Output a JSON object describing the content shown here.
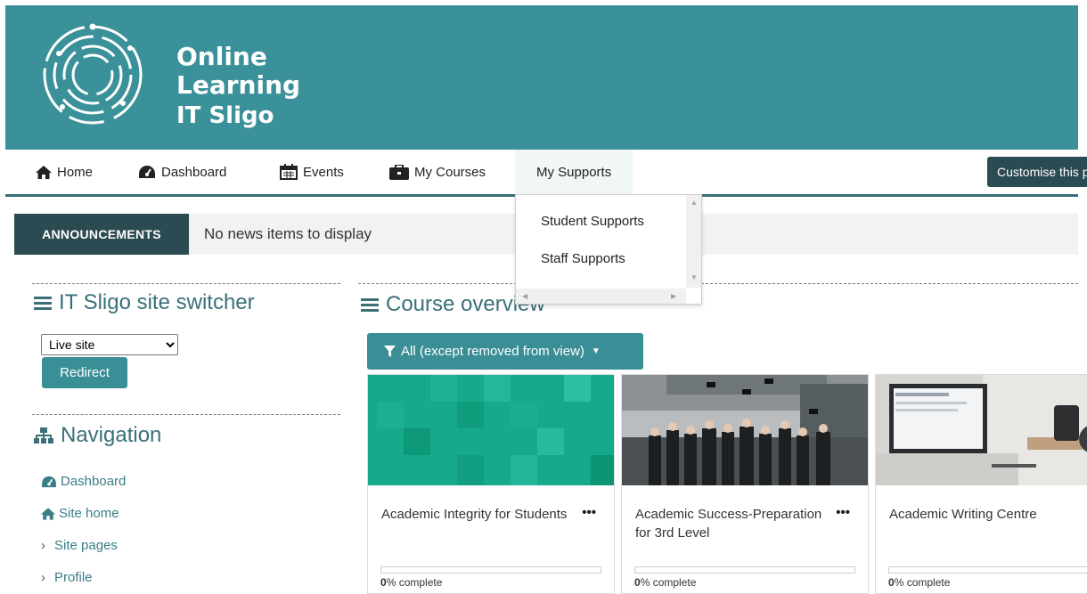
{
  "brand": {
    "line1": "Online",
    "line2": "Learning",
    "line3": "IT Sligo"
  },
  "nav": {
    "home": "Home",
    "dashboard": "Dashboard",
    "events": "Events",
    "my_courses": "My Courses",
    "my_supports": "My Supports",
    "customise": "Customise this page"
  },
  "supports_menu": [
    "Student Supports",
    "Staff Supports"
  ],
  "announcements": {
    "label": "ANNOUNCEMENTS",
    "text": "No news items to display"
  },
  "site_switcher": {
    "title": "IT Sligo site switcher",
    "selected": "Live site",
    "button": "Redirect"
  },
  "navigation": {
    "title": "Navigation",
    "items": [
      "Dashboard",
      "Site home",
      "Site pages",
      "Profile"
    ]
  },
  "course_overview": {
    "title": "Course overview",
    "filter": "All (except removed from view)",
    "courses": [
      {
        "title": "Academic Integrity for Students",
        "progress": 0,
        "progress_label": "0",
        "complete_suffix": "% complete"
      },
      {
        "title": "Academic Success-Preparation for 3rd Level",
        "progress": 0,
        "progress_label": "0",
        "complete_suffix": "% complete"
      },
      {
        "title": "Academic Writing Centre",
        "progress": 0,
        "progress_label": "0",
        "complete_suffix": "% complete"
      }
    ]
  },
  "colors": {
    "teal": "#3a9199",
    "dark": "#2c4a52",
    "link": "#3a7e86"
  }
}
